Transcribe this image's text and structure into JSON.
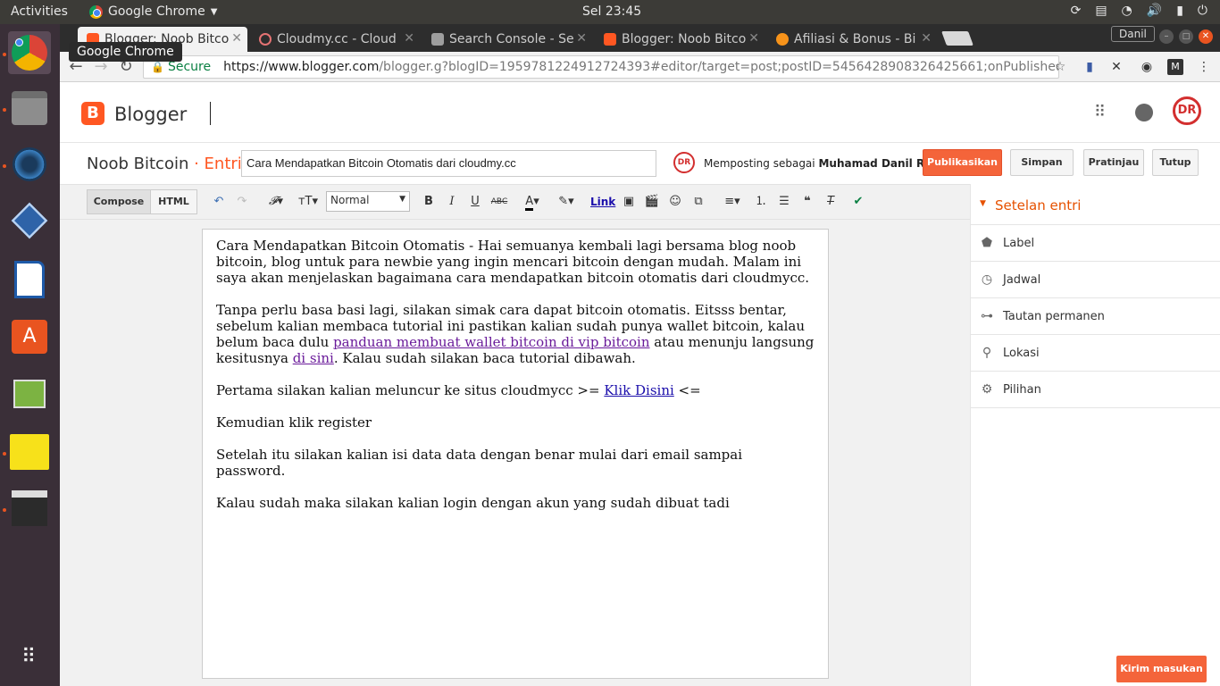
{
  "topbar": {
    "activities": "Activities",
    "app": "Google Chrome",
    "clock": "Sel 23:45"
  },
  "browser": {
    "tabs": [
      {
        "title": "Blogger: Noob Bitcoin",
        "fav_color": "#ff5722"
      },
      {
        "title": "Cloudmy.cc - Cloud",
        "fav_color": "#e57373"
      },
      {
        "title": "Search Console - Se",
        "fav_color": "#9e9e9e"
      },
      {
        "title": "Blogger: Noob Bitcoin",
        "fav_color": "#ff5722"
      },
      {
        "title": "Afiliasi & Bonus - Bi",
        "fav_color": "#f7931a"
      }
    ],
    "profile": "Danil",
    "tooltip": "Google Chrome",
    "secure": "Secure",
    "url_host": "https://www.blogger.com",
    "url_path": "/blogger.g?blogID=1959781224912724393#editor/target=post;postID=5456428908326425661;onPublishedMenu=all…"
  },
  "blogger": {
    "brand": "Blogger",
    "blog_name": "Noob Bitcoin",
    "section": "· Entri",
    "post_title": "Cara Mendapatkan Bitcoin Otomatis dari cloudmy.cc",
    "posting_as": "Memposting sebagai",
    "author": "Muhamad Danil Rafiqi",
    "buttons": {
      "publish": "Publikasikan",
      "save": "Simpan",
      "preview": "Pratinjau",
      "close": "Tutup"
    }
  },
  "editor": {
    "compose": "Compose",
    "html": "HTML",
    "format": "Normal",
    "link": "Link",
    "paragraphs": {
      "p1": "Cara Mendapatkan Bitcoin Otomatis - Hai semuanya kembali lagi bersama blog noob bitcoin, blog untuk para newbie yang ingin mencari bitcoin dengan mudah. Malam ini saya akan menjelaskan bagaimana cara mendapatkan bitcoin otomatis dari cloudmycc.",
      "p2a": "Tanpa perlu basa basi lagi, silakan simak cara dapat bitcoin otomatis. Eitsss bentar, sebelum kalian membaca tutorial ini pastikan kalian sudah punya wallet bitcoin, kalau belum baca dulu ",
      "p2_link1": "panduan membuat wallet bitcoin di vip bitcoin",
      "p2b": " atau menunju langsung kesitusnya ",
      "p2_link2": "di sini",
      "p2c": ". Kalau sudah silakan baca tutorial dibawah.",
      "p3a": "Pertama silakan kalian meluncur ke situs cloudmycc >= ",
      "p3_link": "Klik Disini",
      "p3b": " <=",
      "p4": "Kemudian klik register",
      "p5": "Setelah itu silakan kalian isi data data dengan benar mulai dari email sampai password.",
      "p6": "Kalau sudah maka silakan kalian login dengan akun yang sudah dibuat tadi"
    }
  },
  "sidebar": {
    "heading": "Setelan entri",
    "items": [
      {
        "label": "Label",
        "icon": "tag-icon"
      },
      {
        "label": "Jadwal",
        "icon": "clock-icon"
      },
      {
        "label": "Tautan permanen",
        "icon": "link-icon"
      },
      {
        "label": "Lokasi",
        "icon": "location-pin-icon"
      },
      {
        "label": "Pilihan",
        "icon": "gear-icon"
      }
    ]
  },
  "feedback": "Kirim masukan"
}
